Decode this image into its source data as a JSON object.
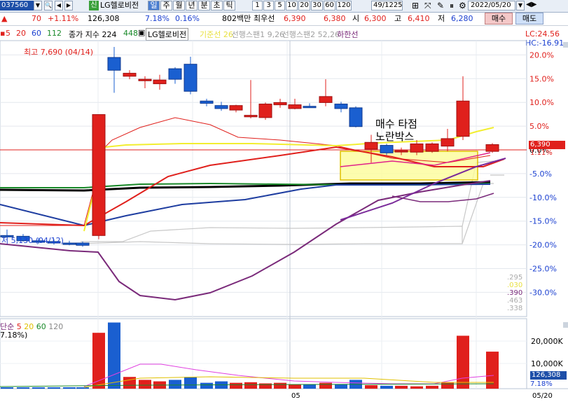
{
  "toolbar": {
    "stock_code": "037560",
    "badge": "신",
    "stock_name": "LG헬로비전",
    "periods": [
      "일",
      "주",
      "월",
      "년",
      "분",
      "초",
      "틱"
    ],
    "active_period": "일",
    "intervals": [
      "1",
      "3",
      "5",
      "10",
      "20",
      "30",
      "60",
      "120"
    ],
    "count": "49/1225",
    "date": "2022/05/20",
    "buy_label": "매수",
    "sell_label": "매도"
  },
  "quote": {
    "change_sign": "▲",
    "change": "70",
    "change_pct": "+1.11%",
    "volume": "126,308",
    "vol_ratio": "7.18%",
    "turnover_pct": "0.16%",
    "amount": "802백만",
    "best_label": "최우선",
    "ask": "6,390",
    "bid": "6,380",
    "open_label": "시",
    "open": "6,300",
    "high_label": "고",
    "high": "6,410",
    "low_label": "저",
    "low": "6,280"
  },
  "legend": {
    "ma_prefix": "5",
    "ma_items": [
      {
        "label": "5",
        "color": "#e0201c"
      },
      {
        "label": "20",
        "color": "#e0201c"
      },
      {
        "label": "60",
        "color": "#1a3fd0"
      },
      {
        "label": "112",
        "color": "#1a8a2a"
      }
    ],
    "close_label": "종가 지수 224",
    "close_extra": "448",
    "stock_tag": "LG헬로비전",
    "ichimoku": [
      {
        "label": "기준선 26",
        "color": "#e8e040"
      },
      {
        "label": "선행스팬1 9,26",
        "color": "#a0a0a0"
      },
      {
        "label": "선행스팬2 52,26",
        "color": "#a0a0a0"
      },
      {
        "label": "하한선",
        "color": "#7a2a7a"
      }
    ],
    "lc": "LC:24.56",
    "hc": "HC:-16.91"
  },
  "annotations": {
    "high_note": "최고 7,690 (04/14)",
    "low_note": "저 5,130 (04/12)",
    "box_title": "매수 타점",
    "box_subtitle": "노란박스",
    "price_tag": "6,390",
    "pct_tag": "1.11%",
    "volume_tag": "126,308",
    "volume_pct_tag": "7.18%",
    "side_values": [
      ".295",
      ".030",
      ".390",
      ".463",
      ".338"
    ]
  },
  "price_axis": [
    "20.0%",
    "15.0%",
    "10.0%",
    "5.0%",
    "0.0%",
    "-5.0%",
    "-10.0%",
    "-15.0%",
    "-20.0%",
    "-25.0%",
    "-30.0%"
  ],
  "volume_legend": {
    "prefix": "단순",
    "items": [
      {
        "label": "5",
        "color": "#e0201c"
      },
      {
        "label": "20",
        "color": "#e0c000"
      },
      {
        "label": "60",
        "color": "#1a8a2a"
      },
      {
        "label": "120",
        "color": "#888888"
      }
    ],
    "sub": "7.18%)"
  },
  "volume_axis": [
    "20,000K",
    "10,000K"
  ],
  "x_axis": {
    "tick": "05",
    "end": "05/20"
  },
  "chart_data": {
    "type": "candlestick",
    "candles": [
      {
        "o": 5180,
        "h": 5260,
        "l": 5140,
        "c": 5170,
        "up": false
      },
      {
        "o": 5170,
        "h": 5200,
        "l": 5100,
        "c": 5110,
        "up": false
      },
      {
        "o": 5110,
        "h": 5150,
        "l": 5070,
        "c": 5090,
        "up": false
      },
      {
        "o": 5100,
        "h": 5130,
        "l": 5060,
        "c": 5080,
        "up": false
      },
      {
        "o": 5080,
        "h": 5110,
        "l": 5050,
        "c": 5070,
        "up": false
      },
      {
        "o": 5080,
        "h": 5100,
        "l": 5030,
        "c": 5050,
        "up": false
      },
      {
        "o": 5180,
        "h": 6790,
        "l": 5130,
        "c": 6790,
        "up": true
      },
      {
        "o": 7550,
        "h": 7690,
        "l": 7080,
        "c": 7380,
        "up": false
      },
      {
        "o": 7340,
        "h": 7380,
        "l": 7260,
        "c": 7300,
        "up": true
      },
      {
        "o": 7260,
        "h": 7300,
        "l": 7140,
        "c": 7240,
        "up": true
      },
      {
        "o": 7250,
        "h": 7320,
        "l": 7120,
        "c": 7200,
        "up": true
      },
      {
        "o": 7400,
        "h": 7420,
        "l": 7200,
        "c": 7260,
        "up": false
      },
      {
        "o": 7460,
        "h": 7560,
        "l": 7060,
        "c": 7100,
        "up": false
      },
      {
        "o": 6970,
        "h": 7000,
        "l": 6900,
        "c": 6940,
        "up": false
      },
      {
        "o": 6910,
        "h": 6960,
        "l": 6840,
        "c": 6870,
        "up": false
      },
      {
        "o": 6850,
        "h": 6920,
        "l": 6820,
        "c": 6910,
        "up": true
      },
      {
        "o": 6760,
        "h": 7250,
        "l": 6740,
        "c": 6780,
        "up": true
      },
      {
        "o": 6750,
        "h": 6950,
        "l": 6720,
        "c": 6930,
        "up": true
      },
      {
        "o": 6920,
        "h": 7000,
        "l": 6880,
        "c": 6950,
        "up": true
      },
      {
        "o": 6870,
        "h": 7000,
        "l": 6860,
        "c": 6920,
        "up": true
      },
      {
        "o": 6900,
        "h": 6940,
        "l": 6880,
        "c": 6900,
        "up": false
      },
      {
        "o": 6950,
        "h": 7260,
        "l": 6900,
        "c": 7030,
        "up": true
      },
      {
        "o": 6930,
        "h": 6960,
        "l": 6820,
        "c": 6870,
        "up": false
      },
      {
        "o": 6880,
        "h": 6900,
        "l": 6620,
        "c": 6630,
        "up": false
      },
      {
        "o": 6420,
        "h": 6520,
        "l": 6150,
        "c": 6330,
        "up": true
      },
      {
        "o": 6380,
        "h": 6400,
        "l": 6250,
        "c": 6280,
        "up": false
      },
      {
        "o": 6310,
        "h": 6350,
        "l": 6250,
        "c": 6300,
        "up": true
      },
      {
        "o": 6290,
        "h": 6450,
        "l": 6250,
        "c": 6400,
        "up": true
      },
      {
        "o": 6300,
        "h": 6420,
        "l": 6280,
        "c": 6400,
        "up": true
      },
      {
        "o": 6370,
        "h": 6600,
        "l": 6300,
        "c": 6470,
        "up": true
      },
      {
        "o": 6500,
        "h": 7300,
        "l": 6450,
        "c": 6970,
        "up": true
      },
      {
        "o": 6300,
        "h": 6410,
        "l": 6280,
        "c": 6390,
        "up": true
      }
    ],
    "volumes": [
      2,
      1,
      1,
      1,
      1,
      1,
      190,
      225,
      40,
      30,
      25,
      30,
      40,
      20,
      25,
      20,
      22,
      18,
      20,
      15,
      15,
      20,
      15,
      30,
      12,
      10,
      10,
      8,
      10,
      20,
      180,
      126
    ]
  }
}
